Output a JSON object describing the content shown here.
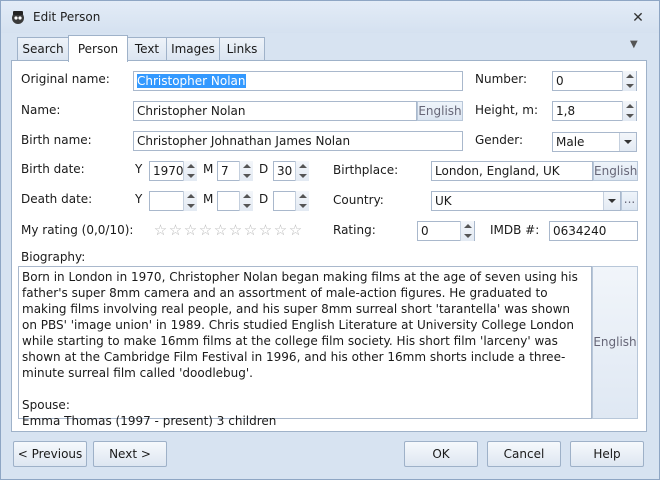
{
  "window": {
    "title": "Edit Person",
    "close_glyph": "✕"
  },
  "tabs": [
    {
      "label": "Search"
    },
    {
      "label": "Person"
    },
    {
      "label": "Text"
    },
    {
      "label": "Images"
    },
    {
      "label": "Links"
    }
  ],
  "form": {
    "original_name_label": "Original name:",
    "original_name_value": "Christopher Nolan",
    "name_label": "Name:",
    "name_value": "Christopher Nolan",
    "birth_name_label": "Birth name:",
    "birth_name_value": "Christopher Johnathan James Nolan",
    "number_label": "Number:",
    "number_value": "0",
    "height_label": "Height, m:",
    "height_value": "1,8",
    "gender_label": "Gender:",
    "gender_value": "Male",
    "birth_date_label": "Birth date:",
    "birth_year": "1970",
    "birth_month": "7",
    "birth_day": "30",
    "death_date_label": "Death date:",
    "y_label": "Y",
    "m_label": "M",
    "d_label": "D",
    "birthplace_label": "Birthplace:",
    "birthplace_value": "London, England, UK",
    "country_label": "Country:",
    "country_value": "UK",
    "country_more": "...",
    "my_rating_label": "My rating (0,0/10):",
    "rating_label": "Rating:",
    "rating_value": "0",
    "imdb_label": "IMDB #:",
    "imdb_value": "0634240",
    "english_label": "English",
    "biography_label": "Biography:",
    "biography_text": "Born in London in 1970, Christopher Nolan began making films at the age of seven using his father's super 8mm camera and an assortment of male-action figures. He graduated to making films involving real people, and his super 8mm surreal short 'tarantella' was shown on PBS' 'image union' in 1989. Chris studied English Literature at University College London while starting to make 16mm films at the college film society. His short film 'larceny' was shown at the Cambridge Film Festival in 1996, and his other 16mm shorts include a three- minute surreal film called 'doodlebug'.\n\nSpouse:\nEmma Thomas (1997 - present) 3 children",
    "star_glyph": "☆"
  },
  "rating_stars": {
    "filled": 0,
    "total": 10
  },
  "buttons": {
    "previous": "< Previous",
    "next": "Next >",
    "ok": "OK",
    "cancel": "Cancel",
    "help": "Help"
  }
}
